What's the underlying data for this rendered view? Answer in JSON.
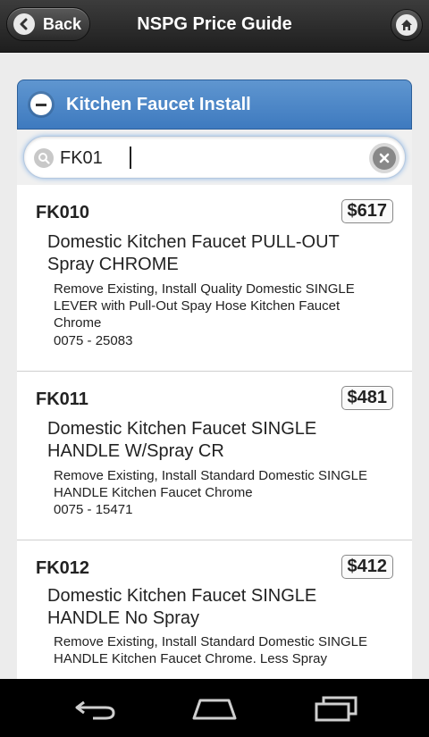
{
  "header": {
    "back_label": "Back",
    "title": "NSPG Price Guide"
  },
  "section": {
    "label": "Kitchen Faucet Install"
  },
  "search": {
    "value": "FK01"
  },
  "items": [
    {
      "code": "FK010",
      "price": "$617",
      "name": "Domestic Kitchen Faucet PULL-OUT Spray CHROME",
      "description": "Remove Existing, Install Quality Domestic SINGLE LEVER with Pull-Out Spay Hose Kitchen Faucet Chrome",
      "sku": "0075 - 25083"
    },
    {
      "code": "FK011",
      "price": "$481",
      "name": "Domestic Kitchen Faucet SINGLE HANDLE W/Spray CR",
      "description": "Remove Existing, Install Standard Domestic SINGLE HANDLE Kitchen Faucet Chrome",
      "sku": "0075 - 15471"
    },
    {
      "code": "FK012",
      "price": "$412",
      "name": "Domestic Kitchen Faucet SINGLE HANDLE No Spray",
      "description": "Remove Existing, Install Standard Domestic SINGLE HANDLE Kitchen Faucet Chrome. Less Spray",
      "sku": ""
    }
  ],
  "colors": {
    "section_blue": "#3e7abf",
    "header_dark": "#1e1e1e"
  }
}
